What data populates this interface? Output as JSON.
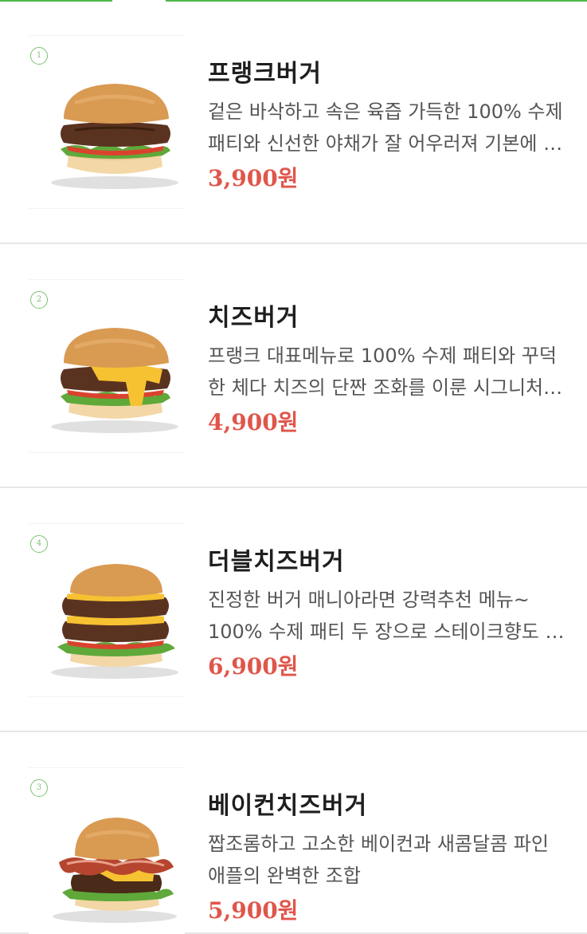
{
  "menu": {
    "items": [
      {
        "rank": "1",
        "name": "프랭크버거",
        "description": "겉은 바삭하고 속은 육즙 가득한 100% 수제패티와 신선한 야채가 잘 어우러져 기본에 충실…",
        "price": "3,900원",
        "image": "hamburger-photo"
      },
      {
        "rank": "2",
        "name": "치즈버거",
        "description": "프랭크 대표메뉴로 100% 수제 패티와 꾸덕한 체다 치즈의 단짠 조화를 이룬 시그니처 버거",
        "price": "4,900원",
        "image": "cheeseburger-photo"
      },
      {
        "rank": "4",
        "name": "더블치즈버거",
        "description": "진정한 버거 매니아라면 강력추천 메뉴~ 100% 수제 패티 두 장으로 스테이크향도 두 배~ 맛…",
        "price": "6,900원",
        "image": "double-cheeseburger-photo"
      },
      {
        "rank": "3",
        "name": "베이컨치즈버거",
        "description": "짭조롬하고 고소한 베이컨과 새콤달콤 파인애플의 완벽한 조합",
        "price": "5,900원",
        "image": "bacon-cheeseburger-photo"
      }
    ]
  },
  "colors": {
    "accent_green": "#4fb84a",
    "price_red": "#e0564a",
    "title_text": "#1e1e1e",
    "desc_text": "#555555"
  }
}
